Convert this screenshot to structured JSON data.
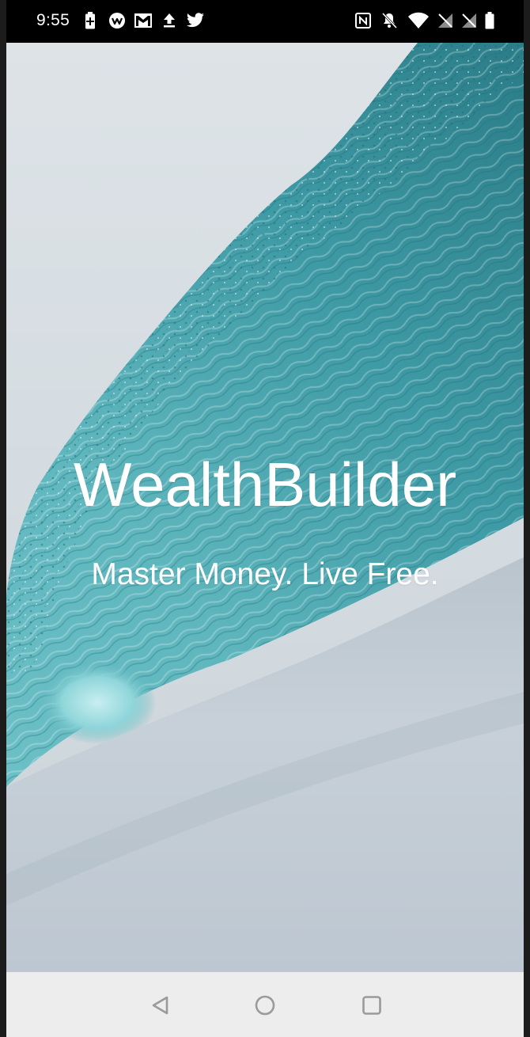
{
  "status_bar": {
    "time": "9:55",
    "left_icons": [
      "battery-saver-icon",
      "app-notification-icon",
      "gmail-icon",
      "upload-icon",
      "twitter-icon"
    ],
    "right_icons": [
      "nfc-icon",
      "notifications-muted-icon",
      "wifi-icon",
      "signal-1-icon",
      "signal-2-icon",
      "battery-icon"
    ]
  },
  "splash": {
    "app_name": "WealthBuilder",
    "tagline": "Master Money. Live Free.",
    "background": "ocean-wave-image",
    "colors": {
      "wave_teal": "#3f9faa",
      "wave_light": "#7cc9cf",
      "sky": "#d4dce1",
      "text": "#ffffff"
    }
  },
  "nav_bar": {
    "buttons": [
      "back-icon",
      "home-icon",
      "recents-icon"
    ]
  }
}
